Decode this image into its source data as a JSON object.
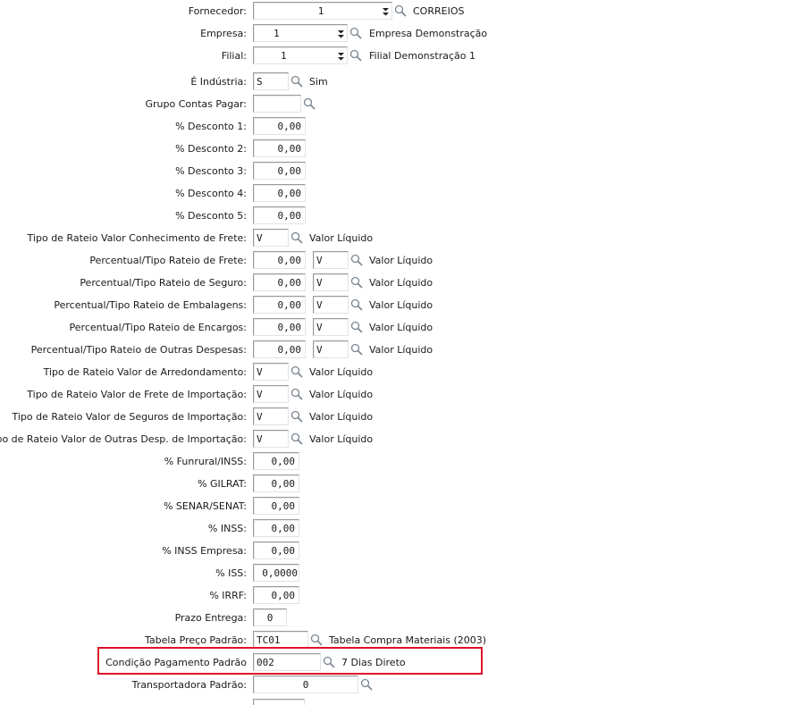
{
  "fornecedor": {
    "label": "Fornecedor:",
    "value": "1",
    "desc": "CORREIOS"
  },
  "empresa": {
    "label": "Empresa:",
    "value": "1",
    "desc": "Empresa Demonstração"
  },
  "filial": {
    "label": "Filial:",
    "value": "1",
    "desc": "Filial Demonstração 1"
  },
  "industria": {
    "label": "É Indústria:",
    "value": "S",
    "desc": "Sim"
  },
  "grupo_contas": {
    "label": "Grupo Contas Pagar:",
    "value": ""
  },
  "desconto1": {
    "label": "% Desconto 1:",
    "value": "0,00"
  },
  "desconto2": {
    "label": "% Desconto 2:",
    "value": "0,00"
  },
  "desconto3": {
    "label": "% Desconto 3:",
    "value": "0,00"
  },
  "desconto4": {
    "label": "% Desconto 4:",
    "value": "0,00"
  },
  "desconto5": {
    "label": "% Desconto 5:",
    "value": "0,00"
  },
  "rateio_conhecimento": {
    "label": "Tipo de Rateio Valor Conhecimento de Frete:",
    "value": "V",
    "desc": "Valor Líquido"
  },
  "perc_frete": {
    "label": "Percentual/Tipo Rateio de Frete:",
    "perc": "0,00",
    "value": "V",
    "desc": "Valor Líquido"
  },
  "perc_seguro": {
    "label": "Percentual/Tipo Rateio de Seguro:",
    "perc": "0,00",
    "value": "V",
    "desc": "Valor Líquido"
  },
  "perc_embalagens": {
    "label": "Percentual/Tipo Rateio de Embalagens:",
    "perc": "0,00",
    "value": "V",
    "desc": "Valor Líquido"
  },
  "perc_encargos": {
    "label": "Percentual/Tipo Rateio de Encargos:",
    "perc": "0,00",
    "value": "V",
    "desc": "Valor Líquido"
  },
  "perc_outras": {
    "label": "Percentual/Tipo Rateio de Outras Despesas:",
    "perc": "0,00",
    "value": "V",
    "desc": "Valor Líquido"
  },
  "rateio_arredondamento": {
    "label": "Tipo de Rateio Valor de Arredondamento:",
    "value": "V",
    "desc": "Valor Líquido"
  },
  "rateio_frete_imp": {
    "label": "Tipo de Rateio Valor de Frete de Importação:",
    "value": "V",
    "desc": "Valor Líquido"
  },
  "rateio_seguros_imp": {
    "label": "Tipo de Rateio Valor de Seguros de Importação:",
    "value": "V",
    "desc": "Valor Líquido"
  },
  "rateio_outras_imp": {
    "label": "Tipo de Rateio Valor de Outras Desp. de Importação:",
    "value": "V",
    "desc": "Valor Líquido"
  },
  "funrural": {
    "label": "% Funrural/INSS:",
    "value": "0,00"
  },
  "gilrat": {
    "label": "% GILRAT:",
    "value": "0,00"
  },
  "senar": {
    "label": "% SENAR/SENAT:",
    "value": "0,00"
  },
  "inss": {
    "label": "% INSS:",
    "value": "0,00"
  },
  "inss_empresa": {
    "label": "% INSS Empresa:",
    "value": "0,00"
  },
  "iss": {
    "label": "% ISS:",
    "value": "0,0000"
  },
  "irrf": {
    "label": "% IRRF:",
    "value": "0,00"
  },
  "prazo_entrega": {
    "label": "Prazo Entrega:",
    "value": "0"
  },
  "tabela_preco": {
    "label": "Tabela Preço Padrão:",
    "value": "TC01",
    "desc": "Tabela Compra Materiais (2003)"
  },
  "condicao_pagamento": {
    "label": "Condição Pagamento Padrão",
    "value": "002",
    "desc": "7 Dias Direto"
  },
  "transportadora": {
    "label": "Transportadora Padrão:",
    "value": "0"
  },
  "colors": {
    "highlight": "#e0102a",
    "border": "#9a9a9a",
    "icon": "#7a8591"
  }
}
